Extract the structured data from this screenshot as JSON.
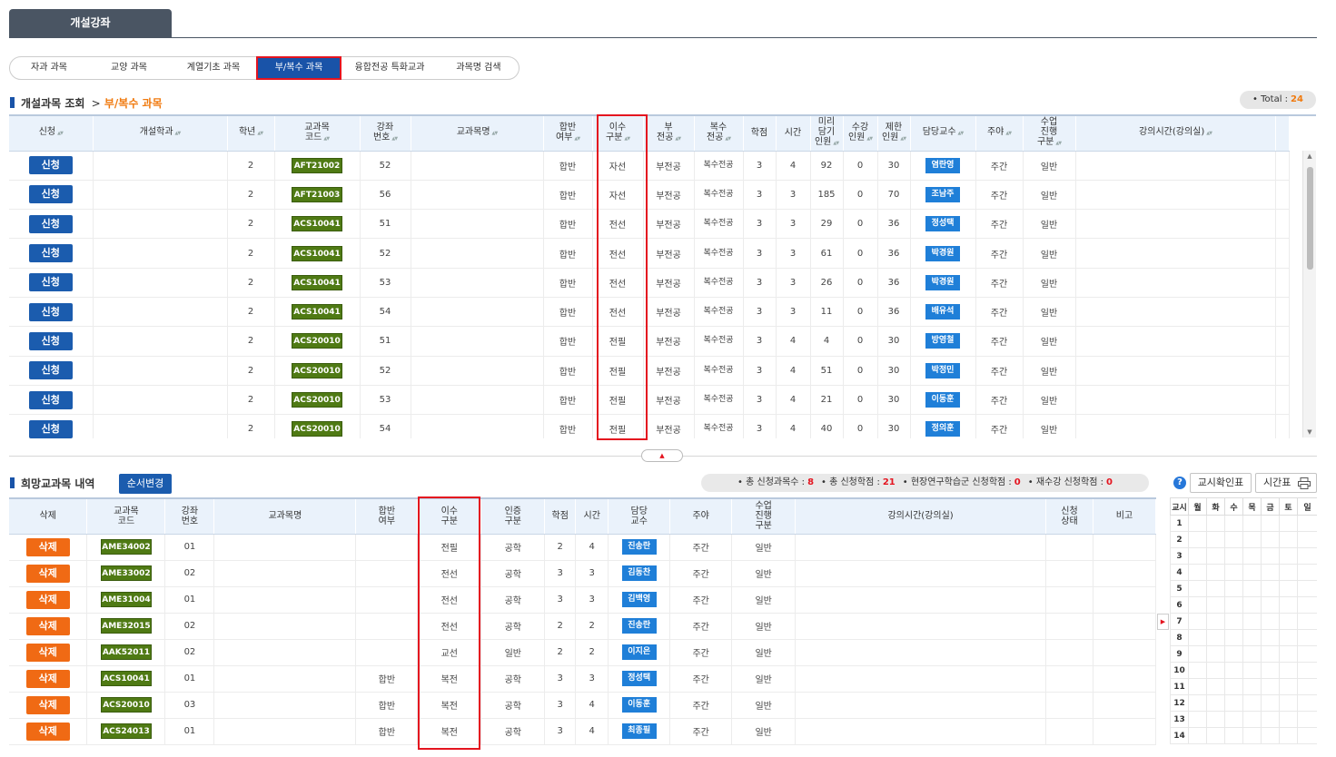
{
  "page_tab": "개설강좌",
  "subtabs": [
    {
      "label": "자과 과목",
      "active": false
    },
    {
      "label": "교양 과목",
      "active": false
    },
    {
      "label": "계열기초 과목",
      "active": false
    },
    {
      "label": "부/복수 과목",
      "active": true
    },
    {
      "label": "융합전공 특화교과",
      "active": false
    },
    {
      "label": "과목명 검색",
      "active": false
    }
  ],
  "courses": {
    "title": "개설과목 조회",
    "breadcrumb_sep": ">",
    "breadcrumb_current": "부/복수 과목",
    "total_label": "• Total :",
    "total_value": "24",
    "headers": [
      "신청",
      "개설학과",
      "학년",
      "교과목\n코드",
      "강좌\n번호",
      "교과목명",
      "합반\n여부",
      "이수\n구분",
      "부\n전공",
      "복수\n전공",
      "학점",
      "시간",
      "미리\n담기\n인원",
      "수강\n인원",
      "제한\n인원",
      "담당교수",
      "주야",
      "수업\n진행\n구분",
      "강의시간(강의실)"
    ],
    "apply_label": "신청",
    "rows": [
      {
        "dept": "",
        "year": "2",
        "code": "AFT21002",
        "section": "52",
        "name": "",
        "merged": "합반",
        "type": "자선",
        "minor": "부전공",
        "double": "복수전공",
        "credit": "3",
        "hours": "4",
        "pre": "92",
        "enrolled": "0",
        "limit": "30",
        "professor": "염란영",
        "daynight": "주간",
        "mode": "일반",
        "time": ""
      },
      {
        "dept": "",
        "year": "2",
        "code": "AFT21003",
        "section": "56",
        "name": "",
        "merged": "합반",
        "type": "자선",
        "minor": "부전공",
        "double": "복수전공",
        "credit": "3",
        "hours": "3",
        "pre": "185",
        "enrolled": "0",
        "limit": "70",
        "professor": "조남주",
        "daynight": "주간",
        "mode": "일반",
        "time": ""
      },
      {
        "dept": "",
        "year": "2",
        "code": "ACS10041",
        "section": "51",
        "name": "",
        "merged": "합반",
        "type": "전선",
        "minor": "부전공",
        "double": "복수전공",
        "credit": "3",
        "hours": "3",
        "pre": "29",
        "enrolled": "0",
        "limit": "36",
        "professor": "정성택",
        "daynight": "주간",
        "mode": "일반",
        "time": ""
      },
      {
        "dept": "",
        "year": "2",
        "code": "ACS10041",
        "section": "52",
        "name": "",
        "merged": "합반",
        "type": "전선",
        "minor": "부전공",
        "double": "복수전공",
        "credit": "3",
        "hours": "3",
        "pre": "61",
        "enrolled": "0",
        "limit": "36",
        "professor": "박경원",
        "daynight": "주간",
        "mode": "일반",
        "time": ""
      },
      {
        "dept": "",
        "year": "2",
        "code": "ACS10041",
        "section": "53",
        "name": "",
        "merged": "합반",
        "type": "전선",
        "minor": "부전공",
        "double": "복수전공",
        "credit": "3",
        "hours": "3",
        "pre": "26",
        "enrolled": "0",
        "limit": "36",
        "professor": "박경원",
        "daynight": "주간",
        "mode": "일반",
        "time": ""
      },
      {
        "dept": "",
        "year": "2",
        "code": "ACS10041",
        "section": "54",
        "name": "",
        "merged": "합반",
        "type": "전선",
        "minor": "부전공",
        "double": "복수전공",
        "credit": "3",
        "hours": "3",
        "pre": "11",
        "enrolled": "0",
        "limit": "36",
        "professor": "배유석",
        "daynight": "주간",
        "mode": "일반",
        "time": ""
      },
      {
        "dept": "",
        "year": "2",
        "code": "ACS20010",
        "section": "51",
        "name": "",
        "merged": "합반",
        "type": "전필",
        "minor": "부전공",
        "double": "복수전공",
        "credit": "3",
        "hours": "4",
        "pre": "4",
        "enrolled": "0",
        "limit": "30",
        "professor": "방영철",
        "daynight": "주간",
        "mode": "일반",
        "time": ""
      },
      {
        "dept": "",
        "year": "2",
        "code": "ACS20010",
        "section": "52",
        "name": "",
        "merged": "합반",
        "type": "전필",
        "minor": "부전공",
        "double": "복수전공",
        "credit": "3",
        "hours": "4",
        "pre": "51",
        "enrolled": "0",
        "limit": "30",
        "professor": "박정민",
        "daynight": "주간",
        "mode": "일반",
        "time": ""
      },
      {
        "dept": "",
        "year": "2",
        "code": "ACS20010",
        "section": "53",
        "name": "",
        "merged": "합반",
        "type": "전필",
        "minor": "부전공",
        "double": "복수전공",
        "credit": "3",
        "hours": "4",
        "pre": "21",
        "enrolled": "0",
        "limit": "30",
        "professor": "이동훈",
        "daynight": "주간",
        "mode": "일반",
        "time": ""
      },
      {
        "dept": "",
        "year": "2",
        "code": "ACS20010",
        "section": "54",
        "name": "",
        "merged": "합반",
        "type": "전필",
        "minor": "부전공",
        "double": "복수전공",
        "credit": "3",
        "hours": "4",
        "pre": "40",
        "enrolled": "0",
        "limit": "30",
        "professor": "정의훈",
        "daynight": "주간",
        "mode": "일반",
        "time": ""
      }
    ]
  },
  "wishlist": {
    "title": "희망교과목 내역",
    "order_button": "순서변경",
    "summary": [
      {
        "label": "• 총 신청과목수 :",
        "value": "8"
      },
      {
        "label": "• 총 신청학점 :",
        "value": "21"
      },
      {
        "label": "• 현장연구학습군 신청학점 :",
        "value": "0"
      },
      {
        "label": "• 재수강 신청학점 :",
        "value": "0"
      }
    ],
    "headers": [
      "삭제",
      "교과목\n코드",
      "강좌\n번호",
      "교과목명",
      "합반\n여부",
      "이수\n구분",
      "인증\n구분",
      "학점",
      "시간",
      "담당\n교수",
      "주야",
      "수업\n진행\n구분",
      "강의시간(강의실)",
      "신청\n상태",
      "비고"
    ],
    "delete_label": "삭제",
    "rows": [
      {
        "code": "AME34002",
        "section": "01",
        "name": "",
        "merged": "",
        "type": "전필",
        "cert": "공학",
        "credit": "2",
        "hours": "4",
        "professor": "진송란",
        "daynight": "주간",
        "mode": "일반",
        "time": "",
        "status": "",
        "note": ""
      },
      {
        "code": "AME33002",
        "section": "02",
        "name": "",
        "merged": "",
        "type": "전선",
        "cert": "공학",
        "credit": "3",
        "hours": "3",
        "professor": "김동찬",
        "daynight": "주간",
        "mode": "일반",
        "time": "",
        "status": "",
        "note": ""
      },
      {
        "code": "AME31004",
        "section": "01",
        "name": "",
        "merged": "",
        "type": "전선",
        "cert": "공학",
        "credit": "3",
        "hours": "3",
        "professor": "김백영",
        "daynight": "주간",
        "mode": "일반",
        "time": "",
        "status": "",
        "note": ""
      },
      {
        "code": "AME32015",
        "section": "02",
        "name": "",
        "merged": "",
        "type": "전선",
        "cert": "공학",
        "credit": "2",
        "hours": "2",
        "professor": "진송란",
        "daynight": "주간",
        "mode": "일반",
        "time": "",
        "status": "",
        "note": ""
      },
      {
        "code": "AAK52011",
        "section": "02",
        "name": "",
        "merged": "",
        "type": "교선",
        "cert": "일반",
        "credit": "2",
        "hours": "2",
        "professor": "이지은",
        "daynight": "주간",
        "mode": "일반",
        "time": "",
        "status": "",
        "note": ""
      },
      {
        "code": "ACS10041",
        "section": "01",
        "name": "",
        "merged": "합반",
        "type": "복전",
        "cert": "공학",
        "credit": "3",
        "hours": "3",
        "professor": "정성택",
        "daynight": "주간",
        "mode": "일반",
        "time": "",
        "status": "",
        "note": ""
      },
      {
        "code": "ACS20010",
        "section": "03",
        "name": "",
        "merged": "합반",
        "type": "복전",
        "cert": "공학",
        "credit": "3",
        "hours": "4",
        "professor": "이동훈",
        "daynight": "주간",
        "mode": "일반",
        "time": "",
        "status": "",
        "note": ""
      },
      {
        "code": "ACS24013",
        "section": "01",
        "name": "",
        "merged": "합반",
        "type": "복전",
        "cert": "공학",
        "credit": "3",
        "hours": "4",
        "professor": "최종필",
        "daynight": "주간",
        "mode": "일반",
        "time": "",
        "status": "",
        "note": ""
      }
    ]
  },
  "timetable": {
    "help_icon": "?",
    "confirm_button": "교시확인표",
    "timetable_button": "시간표",
    "print_icon": "printer-icon",
    "headers": [
      "교시",
      "월",
      "화",
      "수",
      "목",
      "금",
      "토",
      "일"
    ],
    "periods": [
      "1",
      "2",
      "3",
      "4",
      "5",
      "6",
      "7",
      "8",
      "9",
      "10",
      "11",
      "12",
      "13",
      "14"
    ]
  },
  "colors": {
    "primary_blue": "#1b5cae",
    "code_green": "#4f7a14",
    "professor_blue": "#1f7fd8",
    "delete_orange": "#f06a14",
    "highlight_red": "#e4141f",
    "accent_orange": "#f07a0f"
  }
}
